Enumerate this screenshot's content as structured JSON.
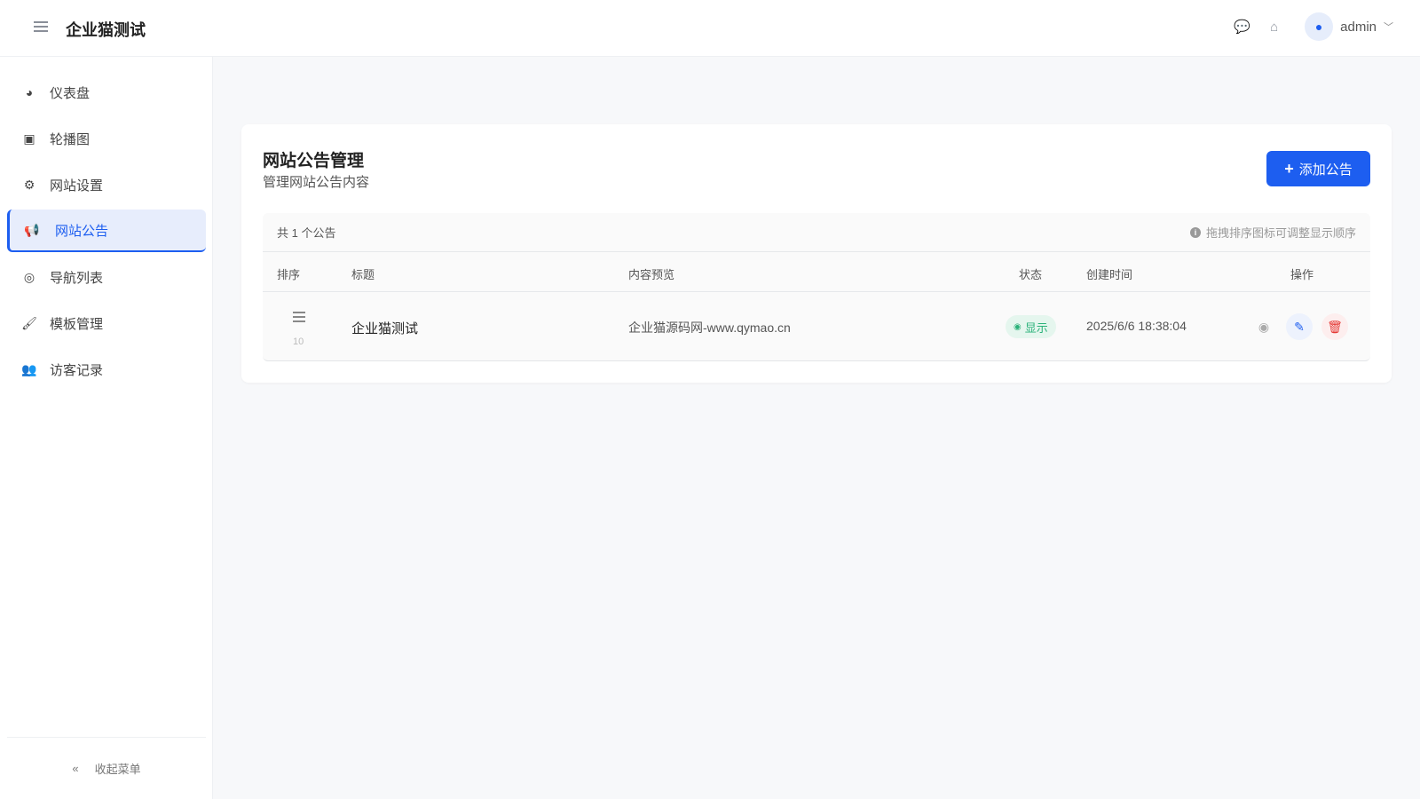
{
  "header": {
    "title": "企业猫测试",
    "user": "admin"
  },
  "sidebar": {
    "items": [
      {
        "label": "仪表盘",
        "icon": "dashboard-icon"
      },
      {
        "label": "轮播图",
        "icon": "image-icon"
      },
      {
        "label": "网站设置",
        "icon": "gear-icon"
      },
      {
        "label": "网站公告",
        "icon": "megaphone-icon",
        "active": true
      },
      {
        "label": "导航列表",
        "icon": "compass-icon"
      },
      {
        "label": "模板管理",
        "icon": "brush-icon"
      },
      {
        "label": "访客记录",
        "icon": "users-icon"
      }
    ],
    "collapse_label": "收起菜单"
  },
  "page": {
    "title": "网站公告管理",
    "subtitle": "管理网站公告内容",
    "add_label": "添加公告"
  },
  "table": {
    "count": "共 1 个公告",
    "hint": "拖拽排序图标可调整显示顺序",
    "columns": [
      "排序",
      "标题",
      "内容预览",
      "状态",
      "创建时间",
      "操作"
    ],
    "rows": [
      {
        "order": "10",
        "title": "企业猫测试",
        "content": "企业猫源码网-www.qymao.cn",
        "status": "显示",
        "created": "2025/6/6 18:38:04"
      }
    ]
  },
  "colors": {
    "accent": "#1d5ef0",
    "success": "#2bb27a",
    "danger": "#e53935"
  }
}
